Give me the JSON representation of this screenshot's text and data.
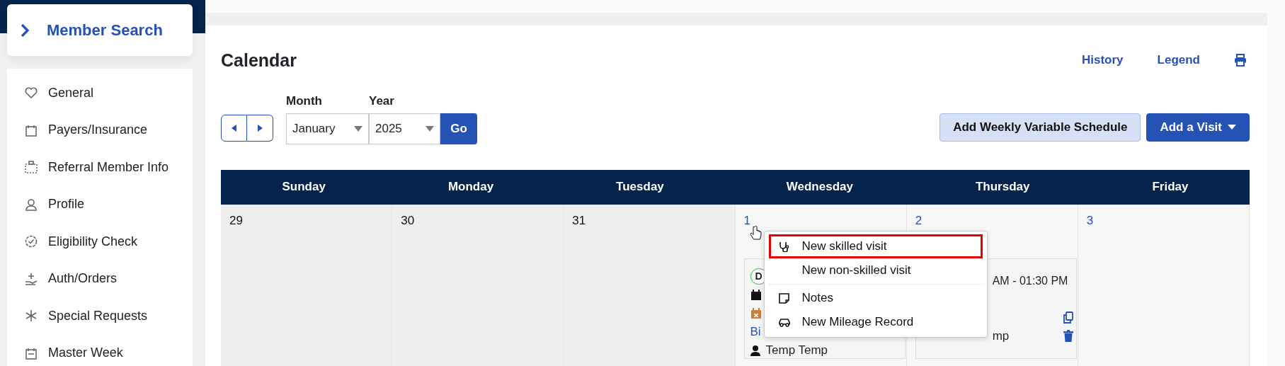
{
  "sidebar": {
    "header": {
      "label": "Member Search"
    },
    "items": [
      {
        "label": "General"
      },
      {
        "label": "Payers/Insurance"
      },
      {
        "label": "Referral Member Info"
      },
      {
        "label": "Profile"
      },
      {
        "label": "Eligibility Check"
      },
      {
        "label": "Auth/Orders"
      },
      {
        "label": "Special Requests"
      },
      {
        "label": "Master Week"
      }
    ]
  },
  "calendar": {
    "title": "Calendar",
    "links": [
      "History",
      "Legend"
    ],
    "month": {
      "label": "Month",
      "value": "January"
    },
    "year": {
      "label": "Year",
      "value": "2025"
    },
    "go_button": "Go",
    "buttons": [
      {
        "label": "Add Weekly Variable Schedule",
        "kind": "secondary"
      },
      {
        "label": "Add a Visit",
        "kind": "dropdown"
      }
    ],
    "columns": [
      "Sunday",
      "Monday",
      "Tuesday",
      "Wednesday",
      "Thursday",
      "Friday"
    ],
    "cells": [
      {
        "day": "29",
        "in_month": false
      },
      {
        "day": "30",
        "in_month": false
      },
      {
        "day": "31",
        "in_month": false
      },
      {
        "day": "1",
        "in_month": true,
        "visit": {
          "badge": "D",
          "link": "Bi",
          "caregiver": "Temp Temp",
          "kind": "partial-left"
        }
      },
      {
        "day": "2",
        "in_month": true,
        "visit": {
          "time": "AM - 01:30 PM",
          "caregiver": "mp",
          "kind": "partial-right"
        }
      },
      {
        "day": "3",
        "in_month": true
      }
    ]
  },
  "context_menu": {
    "items": [
      {
        "label": "New skilled visit",
        "kind": "stethoscope",
        "selected": true,
        "divider_before": false
      },
      {
        "label": "New non-skilled visit",
        "kind": "plain",
        "selected": false,
        "divider_before": false
      },
      {
        "label": "Notes",
        "kind": "note",
        "selected": false,
        "divider_before": true
      },
      {
        "label": "New Mileage Record",
        "kind": "car",
        "selected": false,
        "divider_before": false
      }
    ]
  }
}
